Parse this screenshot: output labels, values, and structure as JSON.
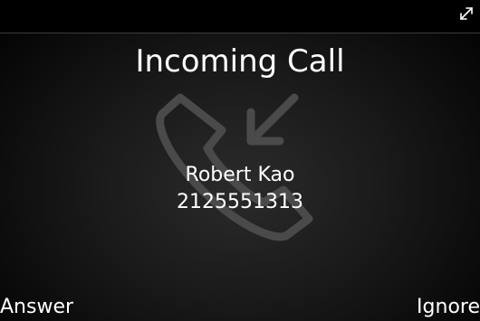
{
  "header": {
    "expand_icon": "expand-arrows-icon"
  },
  "call": {
    "title": "Incoming Call",
    "caller_name": "Robert Kao",
    "caller_number": "2125551313",
    "watermark_icon": "incoming-call-icon"
  },
  "softkeys": {
    "left_label": "Answer",
    "right_label": "Ignore"
  },
  "colors": {
    "text": "#ffffff",
    "background": "#000000",
    "watermark": "#4a4a4a"
  }
}
